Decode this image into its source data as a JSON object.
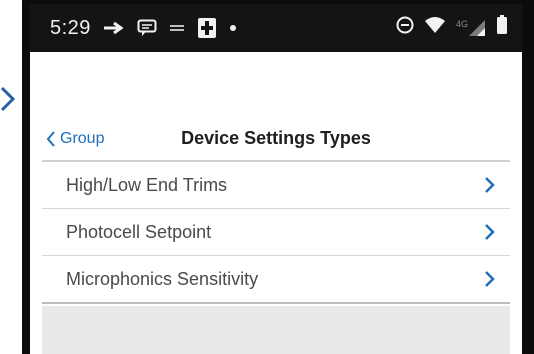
{
  "status_bar": {
    "time": "5:29",
    "icons_left": [
      "arrow-icon",
      "message-icon",
      "minus-icon",
      "app-icon",
      "dot-icon"
    ],
    "icons_right": [
      "dnd-icon",
      "wifi-icon",
      "signal-4g-icon",
      "battery-icon"
    ],
    "network_label": "4G"
  },
  "header": {
    "back_label": "Group",
    "title": "Device Settings Types"
  },
  "settings": {
    "items": [
      {
        "label": "High/Low End Trims"
      },
      {
        "label": "Photocell Setpoint"
      },
      {
        "label": "Microphonics Sensitivity"
      }
    ]
  },
  "colors": {
    "accent": "#1e6fb8",
    "status_bar": "#141414",
    "bottom_area": "#e9e9e9"
  }
}
